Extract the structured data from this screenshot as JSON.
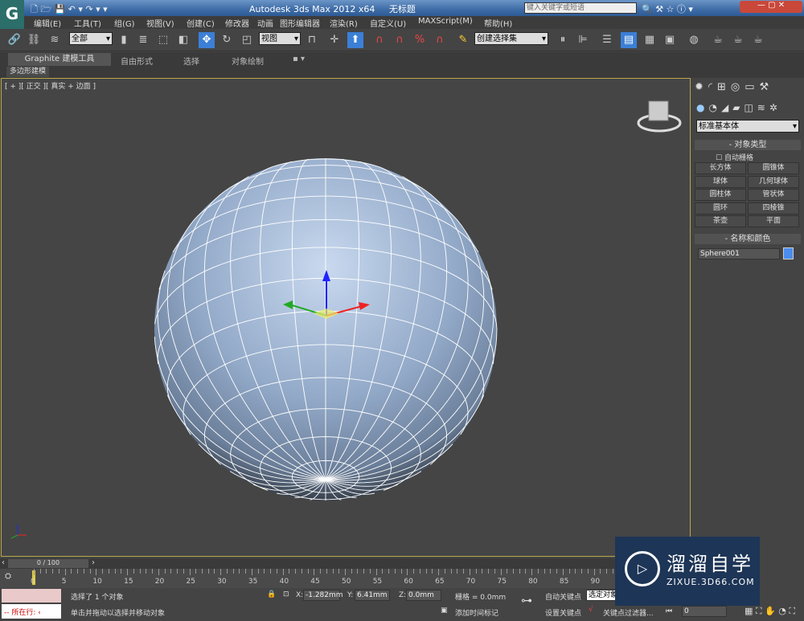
{
  "app": {
    "title": "Autodesk 3ds Max  2012 x64",
    "doc": "无标题",
    "search_placeholder": "键入关键字或短语"
  },
  "menu": [
    "编辑(E)",
    "工具(T)",
    "组(G)",
    "视图(V)",
    "创建(C)",
    "修改器",
    "动画",
    "图形编辑器",
    "渲染(R)",
    "自定义(U)",
    "MAXScript(M)",
    "帮助(H)"
  ],
  "toolbar": {
    "filter": "全部",
    "refcoord": "视图",
    "selset": "创建选择集"
  },
  "ribbon": {
    "tabs": [
      "Graphite 建模工具",
      "自由形式",
      "选择",
      "对象绘制"
    ],
    "sub": "多边形建模"
  },
  "viewport": {
    "label": "[ + ][ 正交 ][ 真实 + 边面 ]"
  },
  "command_panel": {
    "category": "标准基本体",
    "object_type": "对象类型",
    "autogrid": "自动栅格",
    "buttons": [
      "长方体",
      "圆锥体",
      "球体",
      "几何球体",
      "圆柱体",
      "管状体",
      "圆环",
      "四棱锥",
      "茶壶",
      "平面"
    ],
    "name_color": "名称和颜色",
    "object_name": "Sphere001",
    "object_color": "#4a8cf0"
  },
  "timeline": {
    "position": "0 / 100",
    "ticks": [
      "0",
      "5",
      "10",
      "15",
      "20",
      "25",
      "30",
      "35",
      "40",
      "45",
      "50",
      "55",
      "60",
      "65",
      "70",
      "75",
      "80",
      "85",
      "90"
    ]
  },
  "status": {
    "selected": "选择了 1 个对象",
    "prompt": "单击并拖动以选择并移动对象",
    "x": "-1.282mm",
    "y": "6.41mm",
    "z": "0.0mm",
    "grid": "栅格 = 0.0mm",
    "autokey": "自动关键点",
    "setkey": "设置关键点",
    "selected_obj": "选定对象",
    "keyfilter": "关键点过滤器...",
    "add_time_tag": "添加时间标记",
    "frame": "0",
    "maxscript": "所在行:"
  },
  "watermark": {
    "brand": "溜溜自学",
    "url": "ZIXUE.3D66.COM"
  }
}
